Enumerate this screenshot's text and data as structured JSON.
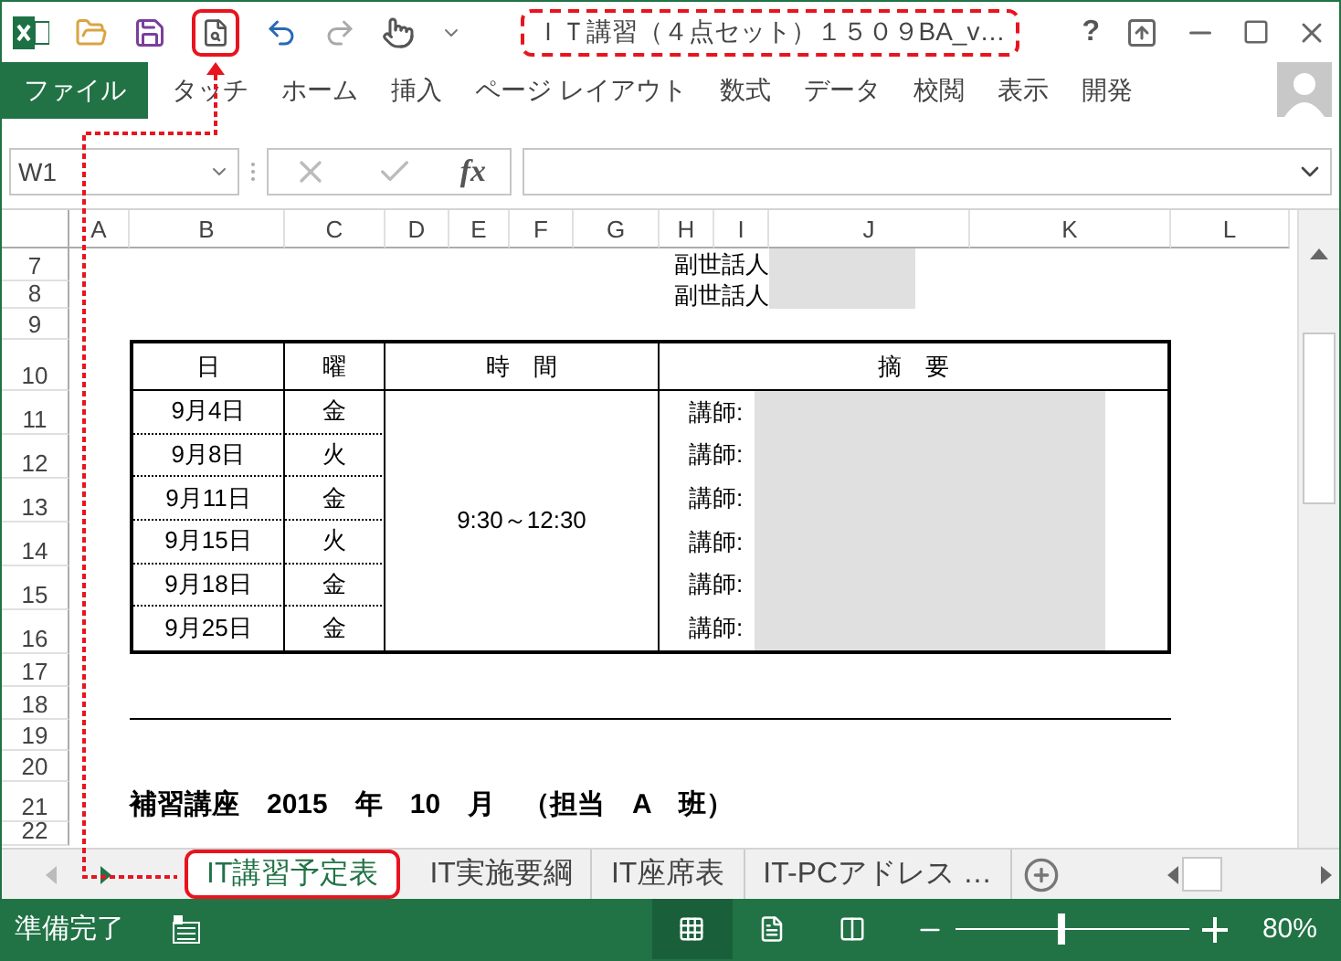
{
  "window": {
    "title": "ＩＴ講習（４点セット）１５０９BA_v…",
    "help": "?"
  },
  "ribbon_tabs": [
    {
      "label": "ファイル",
      "kind": "file"
    },
    {
      "label": "タッチ",
      "kind": "tab"
    },
    {
      "label": "ホーム",
      "kind": "tab"
    },
    {
      "label": "挿入",
      "kind": "tab"
    },
    {
      "label": "ページ レイアウト",
      "kind": "tab"
    },
    {
      "label": "数式",
      "kind": "tab"
    },
    {
      "label": "データ",
      "kind": "tab"
    },
    {
      "label": "校閲",
      "kind": "tab"
    },
    {
      "label": "表示",
      "kind": "tab"
    },
    {
      "label": "開発",
      "kind": "tab"
    }
  ],
  "formula_bar": {
    "name_box": "W1",
    "function_label": "fx"
  },
  "columns": [
    "A",
    "B",
    "C",
    "D",
    "E",
    "F",
    "G",
    "H",
    "I",
    "J",
    "K",
    "L"
  ],
  "rows": [
    "7",
    "8",
    "9",
    "10",
    "11",
    "12",
    "13",
    "14",
    "15",
    "16",
    "17",
    "18",
    "19",
    "20",
    "21",
    "22"
  ],
  "sheet": {
    "helpers": [
      {
        "label": "副世話人"
      },
      {
        "label": "副世話人"
      }
    ],
    "table": {
      "headers": [
        "日",
        "曜",
        "時　間",
        "摘　要"
      ],
      "time": "9:30～12:30",
      "rows": [
        {
          "date": "9月4日",
          "day": "金",
          "note": "講師:"
        },
        {
          "date": "9月8日",
          "day": "火",
          "note": "講師:"
        },
        {
          "date": "9月11日",
          "day": "金",
          "note": "講師:"
        },
        {
          "date": "9月15日",
          "day": "火",
          "note": "講師:"
        },
        {
          "date": "9月18日",
          "day": "金",
          "note": "講師:"
        },
        {
          "date": "9月25日",
          "day": "金",
          "note": "講師:"
        }
      ]
    },
    "heading": "補習講座　2015　年　10　月　（担当　A　班）"
  },
  "sheet_tabs": [
    {
      "label": "IT講習予定表",
      "selected": true
    },
    {
      "label": "IT実施要綱",
      "selected": false
    },
    {
      "label": "IT座席表",
      "selected": false
    },
    {
      "label": "IT-PCアドレス …",
      "selected": false
    }
  ],
  "status_bar": {
    "text": "準備完了",
    "views": [
      {
        "kind": "normal",
        "selected": true
      },
      {
        "kind": "layout",
        "selected": false
      },
      {
        "kind": "break",
        "selected": false
      }
    ],
    "zoom": {
      "level": 0.45,
      "reading": "80%"
    }
  }
}
